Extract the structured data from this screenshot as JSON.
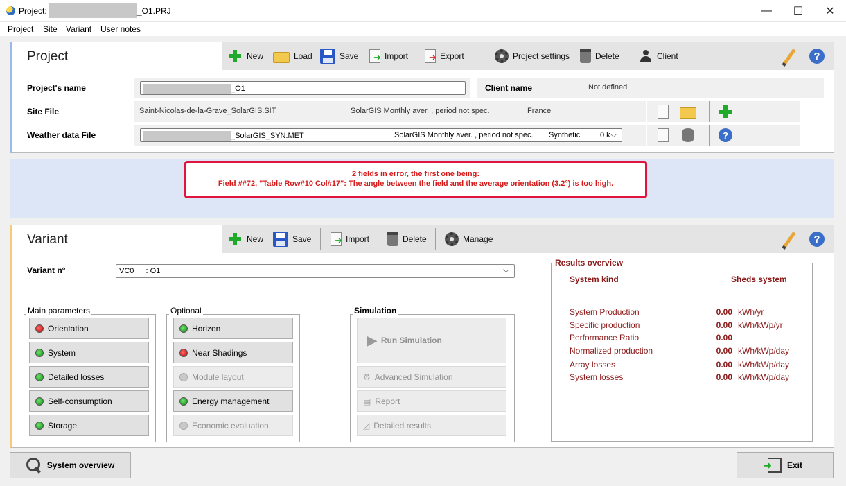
{
  "window": {
    "title_prefix": "Project:",
    "title_file": "_O1.PRJ",
    "minimize": "—",
    "maximize": "☐",
    "close": "✕"
  },
  "menu": [
    "Project",
    "Site",
    "Variant",
    "User notes"
  ],
  "project": {
    "header": "Project",
    "toolbar": {
      "new": "New",
      "load": "Load",
      "save": "Save",
      "import": "Import",
      "export": "Export",
      "settings": "Project settings",
      "delete": "Delete",
      "client": "Client"
    },
    "name_label": "Project's name",
    "name_value": "_O1",
    "client_label": "Client name",
    "client_value": "Not defined",
    "site_label": "Site File",
    "site_file": "Saint-Nicolas-de-la-Grave_SolarGIS.SIT",
    "site_source": "SolarGIS Monthly aver. , period not spec.",
    "site_country": "France",
    "weather_label": "Weather data File",
    "weather_file": "_SolarGIS_SYN.MET",
    "weather_source": "SolarGIS Monthly aver. , period not spec.",
    "weather_type": "Synthetic",
    "weather_extra": "0 k"
  },
  "error": {
    "line1": "2 fields in error, the first one being:",
    "line2": "Field ##72, \"Table Row#10 Col#17\": The angle between the field and the average orientation (3.2°) is too high."
  },
  "variant": {
    "header": "Variant",
    "toolbar": {
      "new": "New",
      "save": "Save",
      "import": "Import",
      "delete": "Delete",
      "manage": "Manage"
    },
    "number_label": "Variant n°",
    "number_code": "VC0",
    "number_name": ": O1",
    "main_params": {
      "legend": "Main parameters",
      "buttons": [
        "Orientation",
        "System",
        "Detailed losses",
        "Self-consumption",
        "Storage"
      ],
      "status": [
        "red",
        "green",
        "green",
        "green",
        "green"
      ]
    },
    "optional": {
      "legend": "Optional",
      "buttons": [
        "Horizon",
        "Near Shadings",
        "Module layout",
        "Energy management",
        "Economic evaluation"
      ],
      "status": [
        "green",
        "red",
        "gray",
        "green",
        "gray"
      ]
    },
    "simulation": {
      "legend": "Simulation",
      "run": "Run Simulation",
      "advanced": "Advanced Simulation",
      "report": "Report",
      "detailed": "Detailed results"
    },
    "results": {
      "legend": "Results overview",
      "kind_label": "System kind",
      "kind_value": "Sheds system",
      "rows": [
        {
          "label": "System Production",
          "value": "0.00",
          "unit": "kWh/yr"
        },
        {
          "label": "Specific production",
          "value": "0.00",
          "unit": "kWh/kWp/yr"
        },
        {
          "label": "Performance Ratio",
          "value": "0.00",
          "unit": ""
        },
        {
          "label": "Normalized production",
          "value": "0.00",
          "unit": "kWh/kWp/day"
        },
        {
          "label": "Array losses",
          "value": "0.00",
          "unit": "kWh/kWp/day"
        },
        {
          "label": "System losses",
          "value": "0.00",
          "unit": "kWh/kWp/day"
        }
      ]
    }
  },
  "bottom": {
    "overview": "System overview",
    "exit": "Exit"
  },
  "colors": {
    "error_red": "#e0143c",
    "result_text": "#8b1a1a",
    "project_accent": "#9ab8e8",
    "variant_accent": "#f7c978"
  }
}
